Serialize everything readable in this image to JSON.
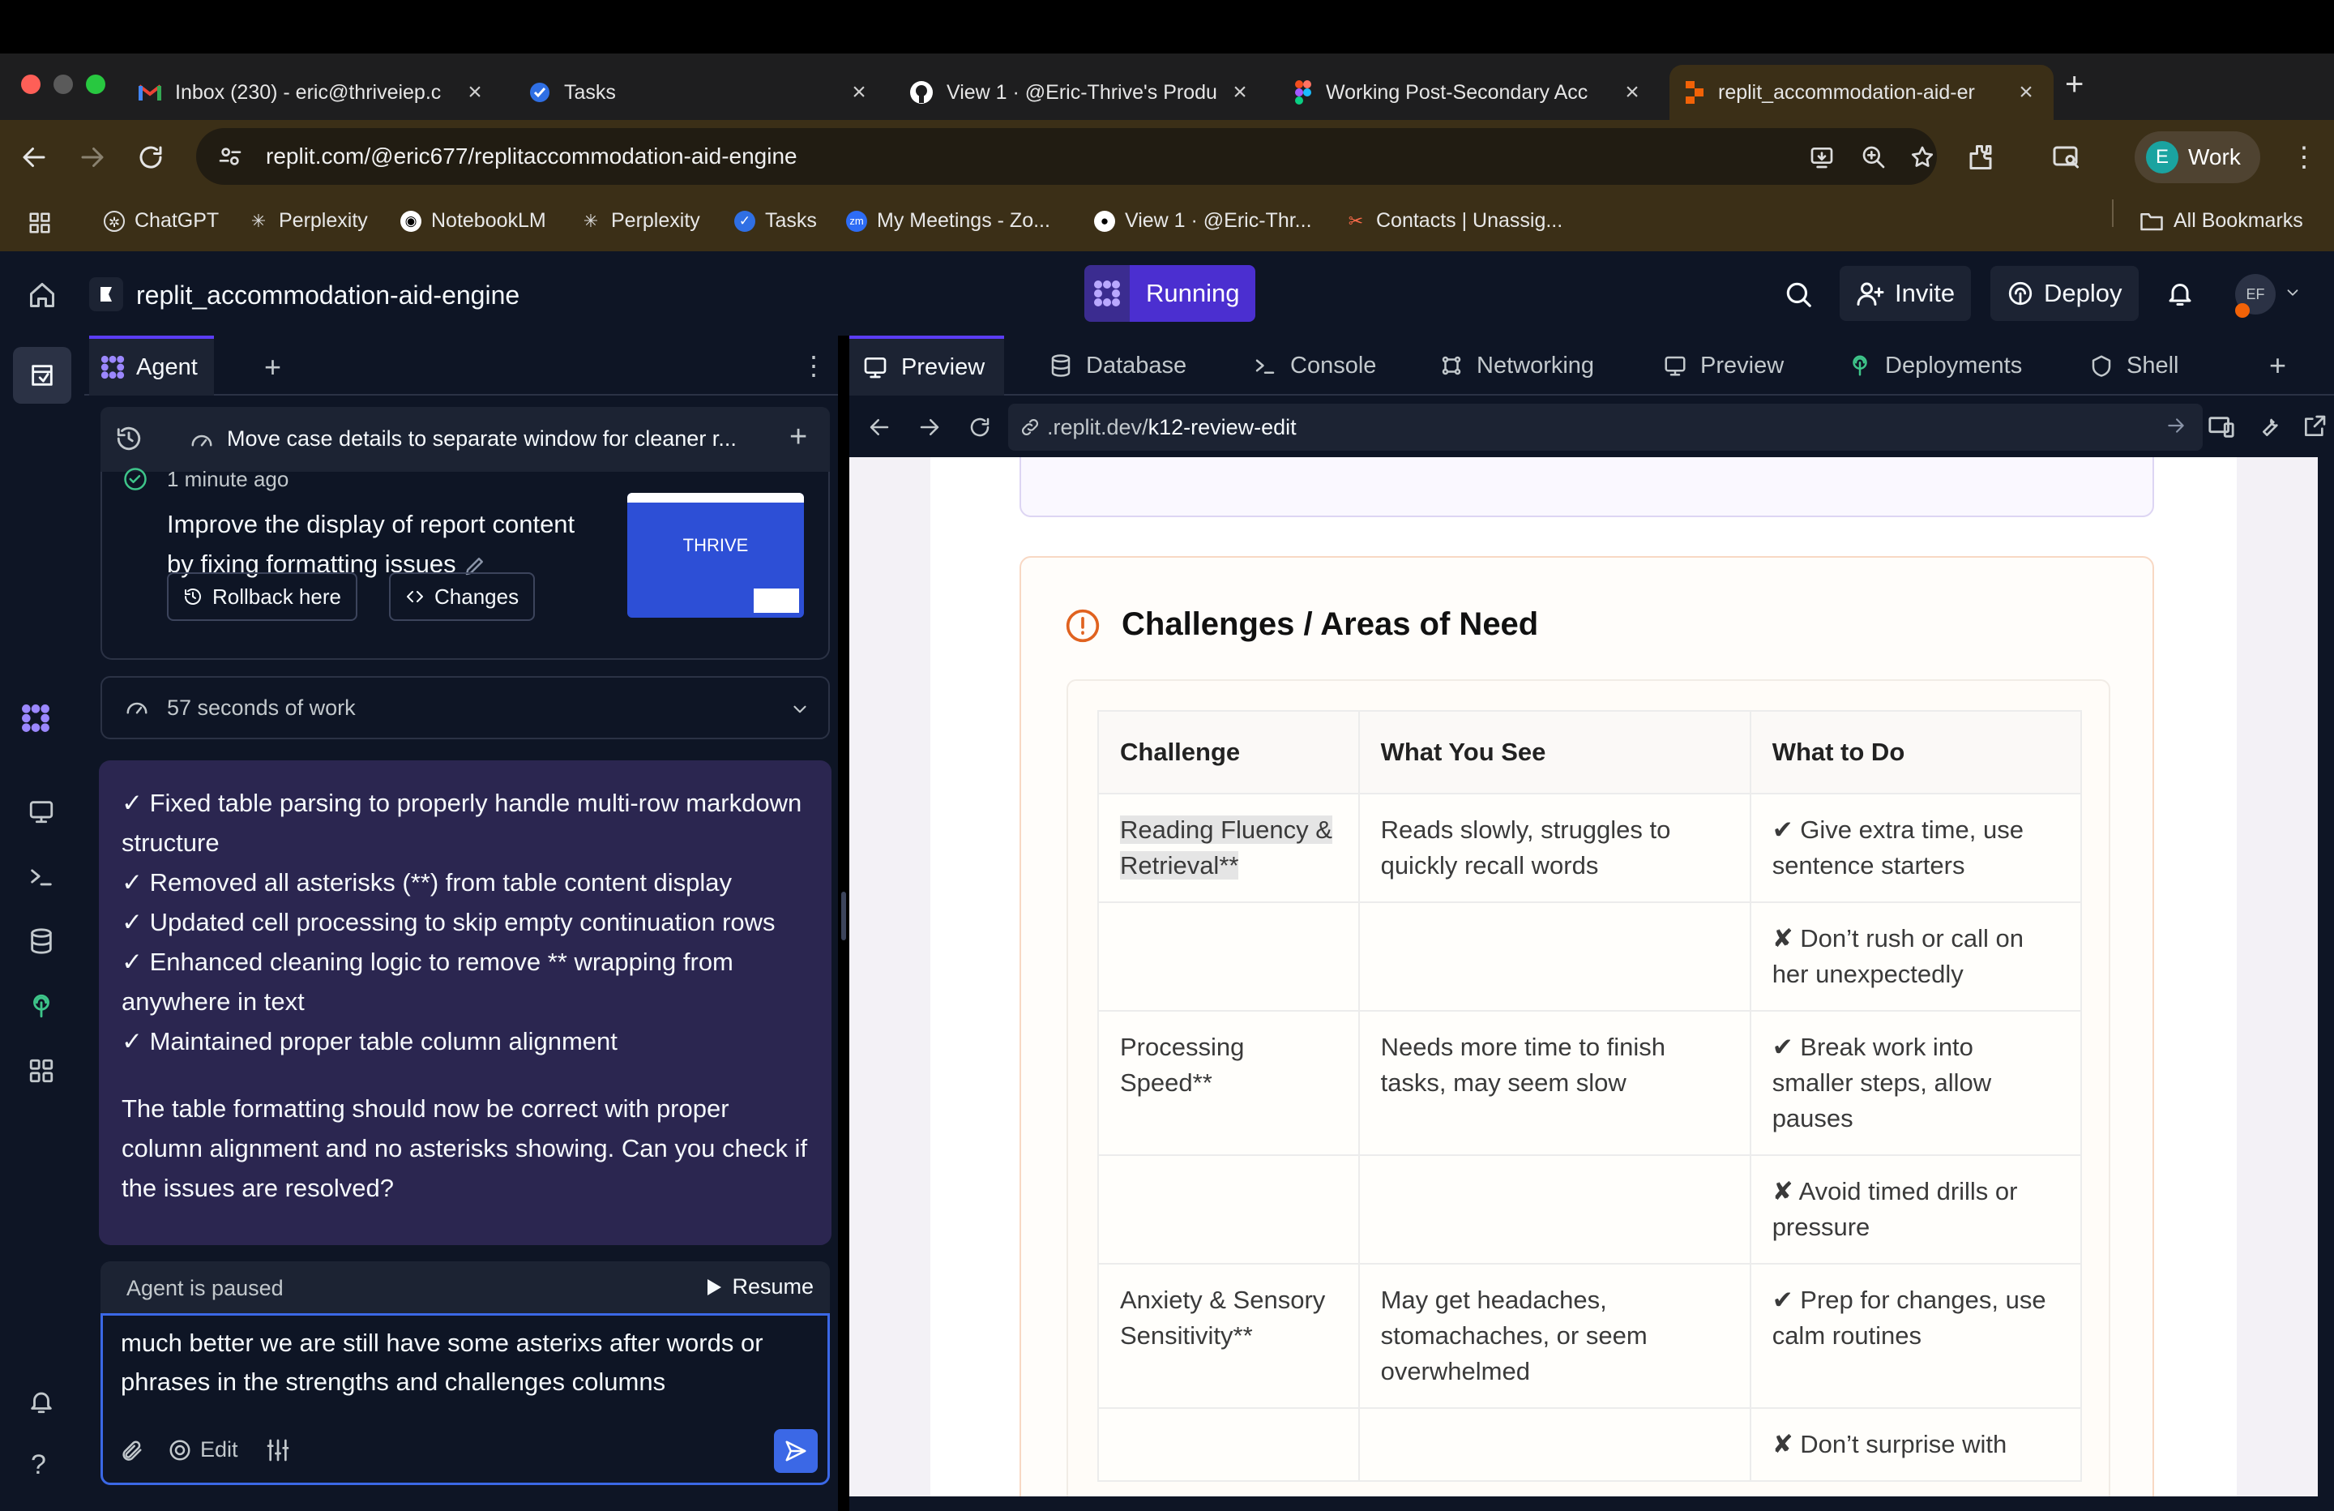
{
  "browser": {
    "tabs": [
      {
        "label": "Inbox (230) - eric@thriveiep.c",
        "icon": "gmail-icon"
      },
      {
        "label": "Tasks",
        "icon": "tasks-icon"
      },
      {
        "label": "View 1 · @Eric-Thrive's Produ",
        "icon": "github-icon"
      },
      {
        "label": "Working Post-Secondary Acc",
        "icon": "figma-icon"
      },
      {
        "label": "replit_accommodation-aid-er",
        "icon": "replit-icon"
      }
    ],
    "url": "replit.com/@eric677/replitaccommodation-aid-engine",
    "profile": {
      "initial": "E",
      "label": "Work"
    },
    "bookmarks": [
      {
        "label": "ChatGPT",
        "icon": "chatgpt-icon"
      },
      {
        "label": "Perplexity",
        "icon": "perplexity-icon"
      },
      {
        "label": "NotebookLM",
        "icon": "notebooklm-icon"
      },
      {
        "label": "Perplexity",
        "icon": "perplexity-icon"
      },
      {
        "label": "Tasks",
        "icon": "tasks-icon"
      },
      {
        "label": "My Meetings - Zo...",
        "icon": "zoom-icon"
      },
      {
        "label": "View 1 · @Eric-Thr...",
        "icon": "github-icon"
      },
      {
        "label": "Contacts | Unassig...",
        "icon": "contacts-icon"
      }
    ],
    "all_bookmarks": "All Bookmarks"
  },
  "replit": {
    "project": "replit_accommodation-aid-engine",
    "run_label": "Running",
    "invite": "Invite",
    "deploy": "Deploy",
    "avatar": "EF"
  },
  "agent": {
    "tab": "Agent",
    "thread_title": "Move case details to separate window for cleaner r...",
    "checkpoint_time": "1 minute ago",
    "checkpoint_desc": "Improve the display of report content by fixing formatting issues",
    "thumb_logo": "THRIVE",
    "rollback": "Rollback here",
    "changes": "Changes",
    "work_time": "57 seconds of work",
    "bullets": [
      "✓ Fixed table parsing to properly handle multi-row markdown structure",
      "✓ Removed all asterisks (**) from table content display",
      "✓ Updated cell processing to skip empty continuation rows",
      "✓ Enhanced cleaning logic to remove ** wrapping from anywhere in text",
      "✓ Maintained proper table column alignment"
    ],
    "summary": "The table formatting should now be correct with proper column alignment and no asterisks showing. Can you check if the issues are resolved?",
    "paused": "Agent is paused",
    "resume": "Resume",
    "input": "much better we are still have some asterixs after words or phrases in the strengths and challenges columns",
    "edit": "Edit"
  },
  "panes": {
    "tabs": [
      "Preview",
      "Database",
      "Console",
      "Networking",
      "Preview",
      "Deployments",
      "Shell"
    ],
    "preview_url_prefix": ".replit.dev/",
    "preview_url_path": "k12-review-edit"
  },
  "report": {
    "section_title": "Challenges / Areas of Need",
    "headers": [
      "Challenge",
      "What You See",
      "What to Do"
    ],
    "rows": [
      [
        "Reading Fluency & Retrieval**",
        "Reads slowly, struggles to quickly recall words",
        "✔ Give extra time, use sentence starters"
      ],
      [
        "",
        "",
        "✘ Don’t rush or call on her unexpectedly"
      ],
      [
        "Processing Speed**",
        "Needs more time to finish tasks, may seem slow",
        "✔ Break work into smaller steps, allow pauses"
      ],
      [
        "",
        "",
        "✘ Avoid timed drills or pressure"
      ],
      [
        "Anxiety & Sensory Sensitivity**",
        "May get headaches, stomachaches, or seem overwhelmed",
        "✔ Prep for changes, use calm routines"
      ],
      [
        "",
        "",
        "✘ Don’t surprise with"
      ]
    ]
  },
  "colors": {
    "accent": "#5b3df5",
    "brand_orange": "#f26207",
    "running_bg": "#4b2fd0",
    "chat_bubble": "#2b2650"
  }
}
